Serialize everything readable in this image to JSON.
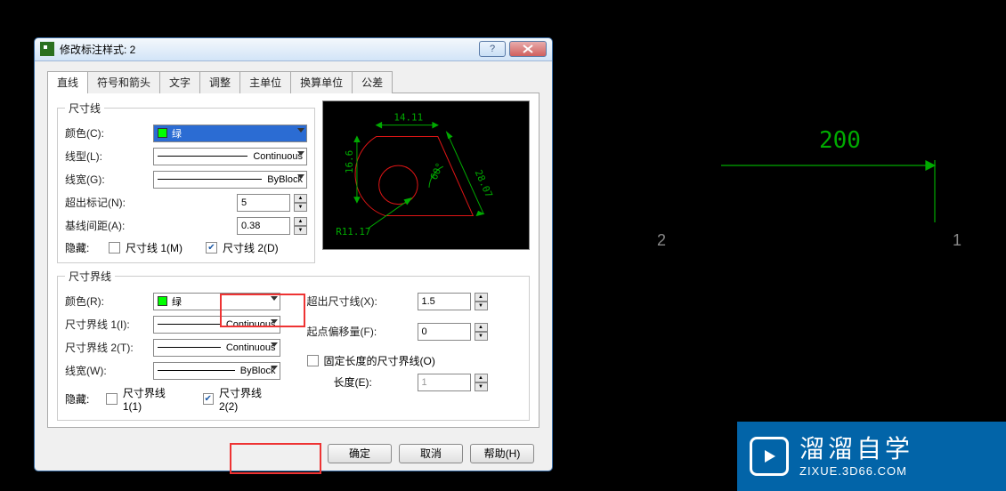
{
  "title": "修改标注样式: 2",
  "tabs": [
    "直线",
    "符号和箭头",
    "文字",
    "调整",
    "主单位",
    "换算单位",
    "公差"
  ],
  "activeTabIndex": 0,
  "dimLine": {
    "legend": "尺寸线",
    "colorLabel": "颜色(C):",
    "colorValue": "绿",
    "linetypeLabel": "线型(L):",
    "linetypeValue": "Continuous",
    "lineweightLabel": "线宽(G):",
    "lineweightValue": "ByBlock",
    "extendTicksLabel": "超出标记(N):",
    "extendTicksValue": "5",
    "baselineSpacingLabel": "基线间距(A):",
    "baselineSpacingValue": "0.38",
    "hideLabel": "隐藏:",
    "dimLine1Label": "尺寸线 1(M)",
    "dimLine1Checked": false,
    "dimLine2Label": "尺寸线 2(D)",
    "dimLine2Checked": true
  },
  "extLine": {
    "legend": "尺寸界线",
    "colorLabel": "颜色(R):",
    "colorValue": "绿",
    "linetype1Label": "尺寸界线 1(I):",
    "linetype1Value": "Continuous",
    "linetype2Label": "尺寸界线 2(T):",
    "linetype2Value": "Continuous",
    "lineweightLabel": "线宽(W):",
    "lineweightValue": "ByBlock",
    "hideLabel": "隐藏:",
    "extLine1Label": "尺寸界线 1(1)",
    "extLine1Checked": false,
    "extLine2Label": "尺寸界线 2(2)",
    "extLine2Checked": true,
    "extendBeyondLabel": "超出尺寸线(X):",
    "extendBeyondValue": "1.5",
    "offsetOriginLabel": "起点偏移量(F):",
    "offsetOriginValue": "0",
    "fixedLengthLabel": "固定长度的尺寸界线(O)",
    "fixedLengthChecked": false,
    "lengthLabel": "长度(E):",
    "lengthValue": "1"
  },
  "buttons": {
    "ok": "确定",
    "cancel": "取消",
    "help": "帮助(H)"
  },
  "preview": {
    "top": "14.11",
    "left": "16.6",
    "angle": "60°",
    "diag": "28.07",
    "radius": "R11.17"
  },
  "cad": {
    "dim": "200",
    "p1": "1",
    "p2": "2"
  },
  "logo": {
    "cn": "溜溜自学",
    "en": "ZIXUE.3D66.COM"
  }
}
